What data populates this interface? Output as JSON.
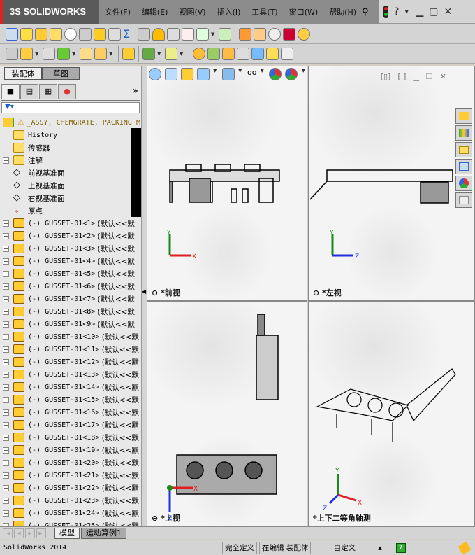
{
  "app": {
    "logo": "SOLIDWORKS"
  },
  "menu": [
    "文件(F)",
    "编辑(E)",
    "视图(V)",
    "插入(I)",
    "工具(T)",
    "窗口(W)",
    "帮助(H)"
  ],
  "window_controls": {
    "help": "?"
  },
  "panel": {
    "tabs": [
      "装配体",
      "草图"
    ],
    "more": "»",
    "tree_root": "_ASSY, CHEMGRATE, PACKING M",
    "tree_items": [
      "History",
      "传感器",
      "注解",
      "前视基准面",
      "上视基准面",
      "右视基准面",
      "原点"
    ],
    "gusset_suffix": "(默认<<默",
    "gussets": [
      "(-) GUSSET-01<1>",
      "(-) GUSSET-01<2>",
      "(-) GUSSET-01<3>",
      "(-) GUSSET-01<4>",
      "(-) GUSSET-01<5>",
      "(-) GUSSET-01<6>",
      "(-) GUSSET-01<7>",
      "(-) GUSSET-01<8>",
      "(-) GUSSET-01<9>",
      "(-) GUSSET-01<10>",
      "(-) GUSSET-01<11>",
      "(-) GUSSET-01<12>",
      "(-) GUSSET-01<13>",
      "(-) GUSSET-01<14>",
      "(-) GUSSET-01<15>",
      "(-) GUSSET-01<16>",
      "(-) GUSSET-01<17>",
      "(-) GUSSET-01<18>",
      "(-) GUSSET-01<19>",
      "(-) GUSSET-01<20>",
      "(-) GUSSET-01<21>",
      "(-) GUSSET-01<22>",
      "(-) GUSSET-01<23>",
      "(-) GUSSET-01<24>",
      "(-) GUSSET-01<25>"
    ]
  },
  "viewports": {
    "front": "*前视",
    "left": "*左视",
    "top": "*上视",
    "iso": "*上下二等角轴测"
  },
  "axes": {
    "x": "X",
    "y": "Y",
    "z": "Z"
  },
  "bottom_tabs": [
    "模型",
    "运动算例1"
  ],
  "status": {
    "app": "SolidWorks 2014",
    "state": "完全定义",
    "editing": "在编辑 装配体",
    "units": "自定义"
  },
  "colors": {
    "accent_red": "#dd2222",
    "x_axis": "#e02020",
    "y_axis": "#1a8a1a",
    "z_axis": "#2030e0"
  }
}
